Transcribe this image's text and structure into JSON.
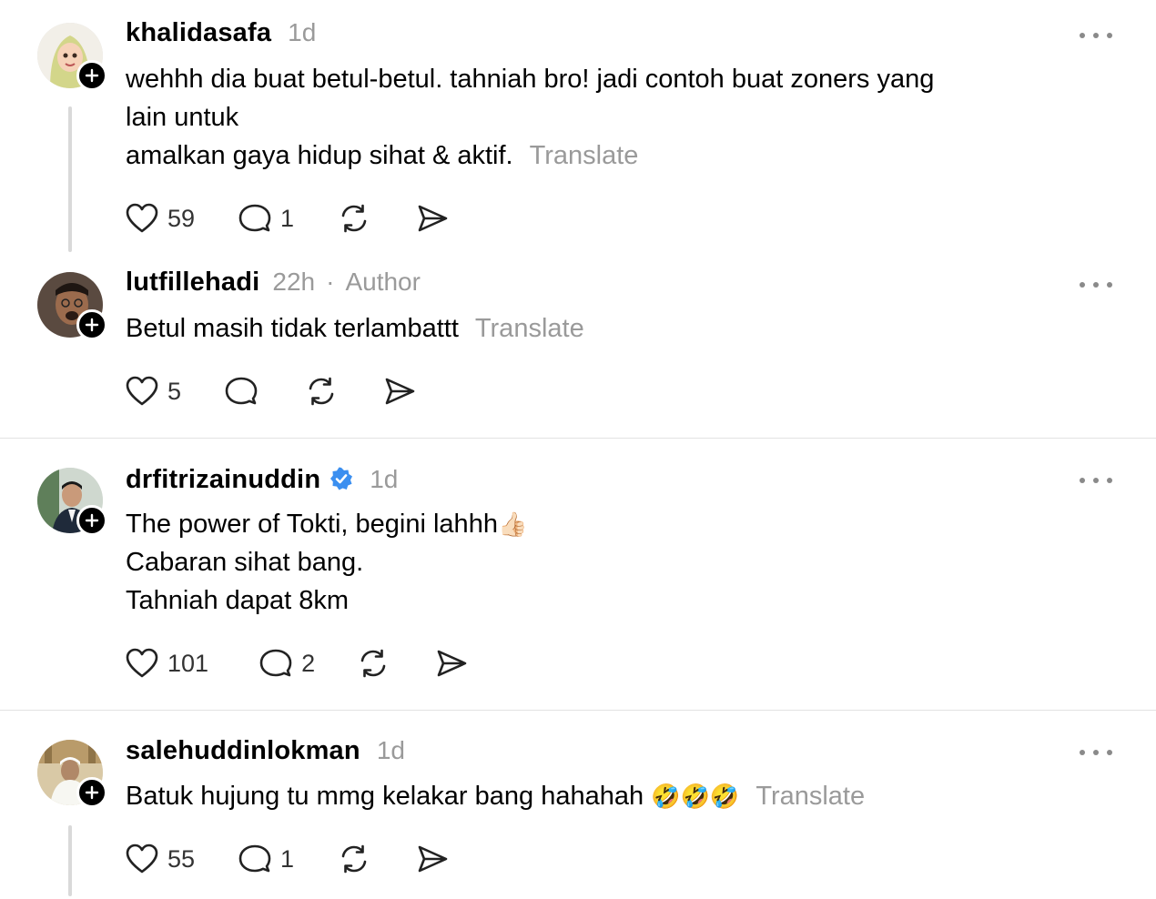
{
  "posts": [
    {
      "username": "khalidasafa",
      "time": "1d",
      "author_label": "",
      "verified": false,
      "lines": [
        "wehhh dia buat betul-betul. tahniah bro! jadi contoh buat zoners yang",
        "lain untuk",
        "amalkan gaya hidup sihat & aktif."
      ],
      "translate": "Translate",
      "likes": "59",
      "replies": "1"
    },
    {
      "username": "lutfillehadi",
      "time": "22h",
      "author_label": "Author",
      "separator": "·",
      "verified": false,
      "lines": [
        "Betul masih tidak terlambattt"
      ],
      "translate": "Translate",
      "likes": "5",
      "replies": ""
    },
    {
      "username": "drfitrizainuddin",
      "time": "1d",
      "verified": true,
      "lines": [
        "The power of Tokti, begini lahhh",
        "Cabaran sihat bang.",
        "Tahniah dapat 8km"
      ],
      "emoji_line1": "👍🏻",
      "translate": "",
      "likes": "101",
      "replies": "2"
    },
    {
      "username": "salehuddinlokman",
      "time": "1d",
      "verified": false,
      "lines": [
        "Batuk hujung tu mmg kelakar bang hahahah"
      ],
      "emoji_line1": "🤣🤣🤣",
      "translate": "Translate",
      "likes": "55",
      "replies": "1"
    }
  ],
  "colors": {
    "muted": "#9a9a9a",
    "verified_blue": "#3b8ff0",
    "divider": "#e3e3e3",
    "thread_line": "#d9d9d9"
  },
  "icons": [
    "heart-icon",
    "comment-icon",
    "repost-icon",
    "share-icon",
    "more-icon",
    "plus-icon",
    "verified-icon"
  ]
}
